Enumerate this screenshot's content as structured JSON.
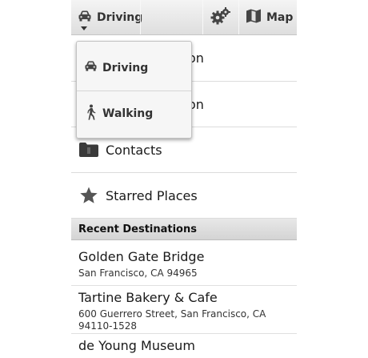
{
  "action_bar": {
    "mode_label": "Driving",
    "map_label": "Map",
    "icons": {
      "mode": "car-icon",
      "settings": "gears-icon",
      "map": "map-icon"
    }
  },
  "list": {
    "item1_tail": "on",
    "item2_tail": "on",
    "contacts_label": "Contacts",
    "starred_label": "Starred Places"
  },
  "recent": {
    "header": "Recent Destinations",
    "items": [
      {
        "name": "Golden Gate Bridge",
        "address": "San Francisco, CA 94965"
      },
      {
        "name": "Tartine Bakery & Cafe",
        "address_line1": "600 Guerrero Street, San Francisco, CA",
        "address_line2": "94110-1528"
      },
      {
        "name": "de Young Museum"
      }
    ]
  },
  "dropdown": {
    "items": [
      {
        "label": "Driving",
        "icon": "car-icon"
      },
      {
        "label": "Walking",
        "icon": "walking-person-icon"
      }
    ]
  }
}
